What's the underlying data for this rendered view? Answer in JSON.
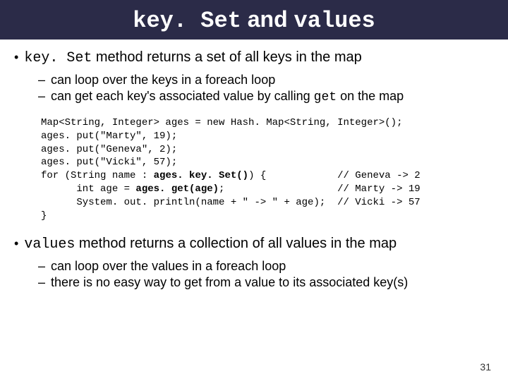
{
  "title": {
    "part1": "key. Set",
    "joiner": " and ",
    "part2": "values"
  },
  "bullet1": {
    "code": "key. Set",
    "rest": " method returns a set of all keys in the map"
  },
  "sub1": {
    "a": "can loop over the keys in a foreach loop",
    "b_prefix": "can get each key's associated value by calling ",
    "b_code": "get",
    "b_suffix": " on the map"
  },
  "code": {
    "l1": "Map<String, Integer> ages = new Hash. Map<String, Integer>();",
    "l2": "ages. put(\"Marty\", 19);",
    "l3": "ages. put(\"Geneva\", 2);",
    "l4": "ages. put(\"Vicki\", 57);",
    "l5a": "for (String name : ",
    "l5b": "ages. key. Set()",
    "l5c": ") {            // Geneva -> 2",
    "l6a": "      int age = ",
    "l6b": "ages. get(age)",
    "l6c": ";                   // Marty -> 19",
    "l7": "      System. out. println(name + \" -> \" + age);  // Vicki -> 57",
    "l8": "}"
  },
  "bullet2": {
    "code": "values",
    "rest": " method returns a collection of all values in the map"
  },
  "sub2": {
    "a": "can loop over the values in a foreach loop",
    "b": "there is no easy way to get from a value to its associated key(s)"
  },
  "slide_number": "31"
}
